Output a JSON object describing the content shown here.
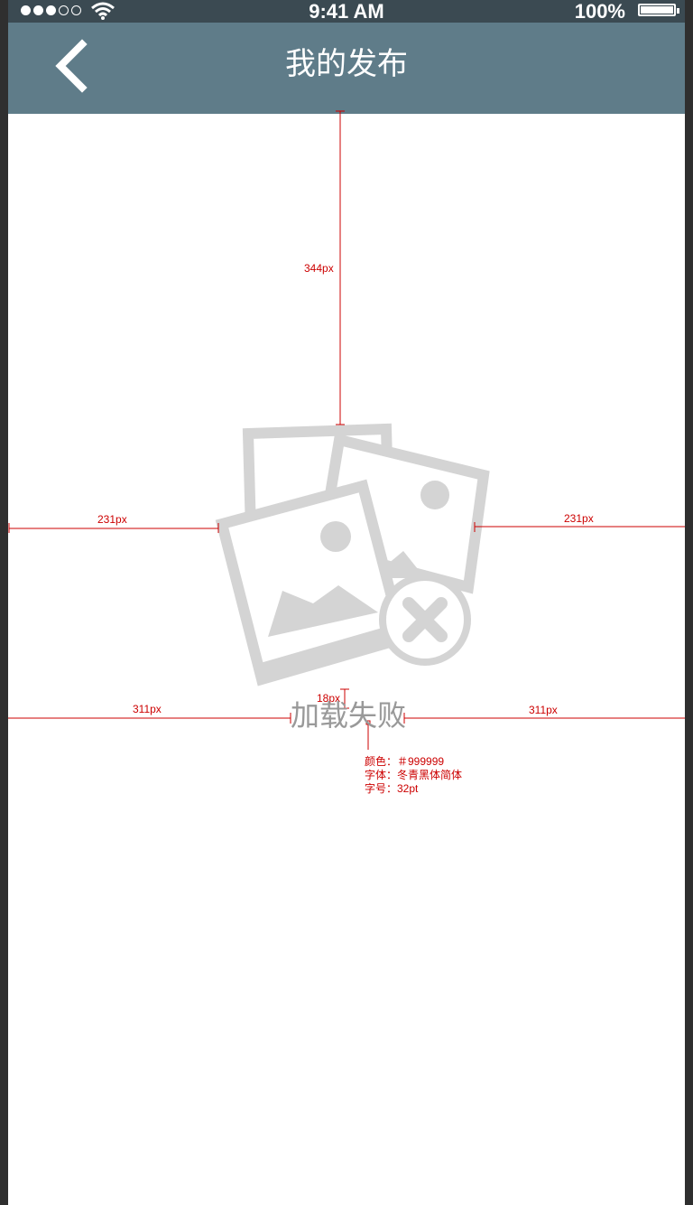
{
  "status_bar": {
    "signal": [
      "on",
      "on",
      "on",
      "off",
      "off"
    ],
    "time": "9:41 AM",
    "battery_text": "100%"
  },
  "nav": {
    "back_icon": "chevron-left-icon",
    "title": "我的发布"
  },
  "content": {
    "illustration_icon": "image-load-failed-icon",
    "message": "加载失败"
  },
  "annotations": {
    "top_gap": "344px",
    "left_gap": "231px",
    "right_gap": "231px",
    "text_gap": "18px",
    "text_left": "311px",
    "text_right": "311px",
    "spec_color": "颜色：＃999999",
    "spec_font": "字体：冬青黑体简体",
    "spec_size": "字号：32pt"
  },
  "colors": {
    "status_bar": "#3b4a52",
    "nav_bar": "#5f7c89",
    "illustration": "#d4d4d4",
    "message": "#999999",
    "annotation": "#cc0000"
  }
}
